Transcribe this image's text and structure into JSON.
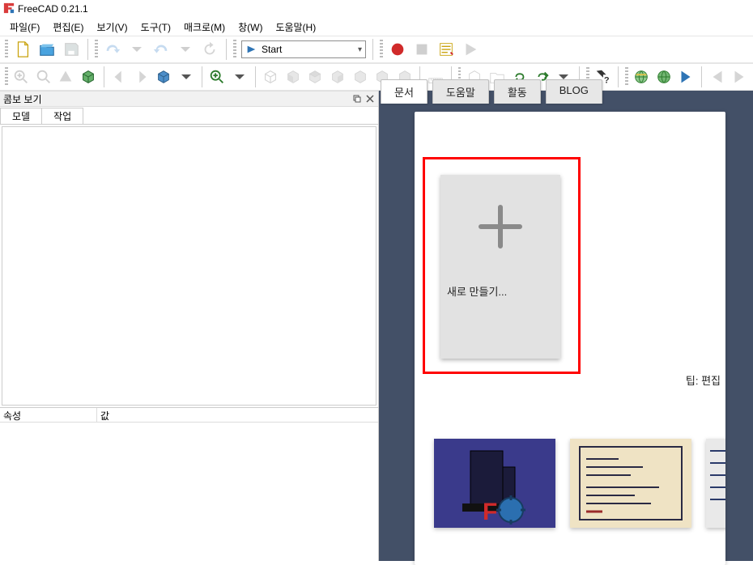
{
  "app": {
    "title": "FreeCAD 0.21.1"
  },
  "menu": {
    "items": [
      "파일(F)",
      "편집(E)",
      "보기(V)",
      "도구(T)",
      "매크로(M)",
      "창(W)",
      "도움말(H)"
    ]
  },
  "workbench": {
    "selected": "Start"
  },
  "panels": {
    "combo_title": "콤보 보기",
    "tabs": [
      "모델",
      "작업"
    ],
    "property_columns": [
      "속성",
      "값"
    ]
  },
  "startpage": {
    "tabs": [
      "문서",
      "도움말",
      "활동",
      "BLOG"
    ],
    "active_tab": 0,
    "new_card_label": "새로 만들기...",
    "tip_prefix": "팁:",
    "tip_text": "편집"
  }
}
